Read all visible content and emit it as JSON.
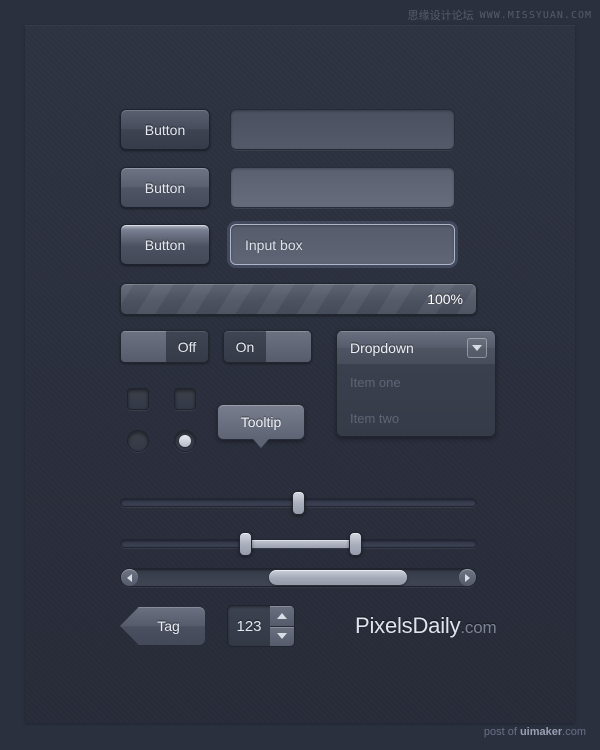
{
  "watermarks": {
    "top_cjk": "思缘设计论坛",
    "top_url": "WWW.MISSYUAN.COM",
    "bottom_prefix": "post of ",
    "bottom_brand": "uimaker",
    "bottom_suffix": ".com"
  },
  "buttons": {
    "normal_label": "Button",
    "hover_label": "Button",
    "active_label": "Button"
  },
  "inputs": {
    "plain_value": "",
    "light_value": "",
    "focused_value": "Input box"
  },
  "progress": {
    "label": "100%",
    "value": 100
  },
  "toggles": {
    "off_label": "Off",
    "on_label": "On"
  },
  "dropdown": {
    "title": "Dropdown",
    "arrow_icon": "chevron-down-icon",
    "items": [
      {
        "label": "Item one"
      },
      {
        "label": "Item two"
      }
    ]
  },
  "checkboxes": [
    {
      "checked": false
    },
    {
      "checked": false
    }
  ],
  "radios": [
    {
      "checked": false
    },
    {
      "checked": true
    }
  ],
  "tooltip": {
    "label": "Tooltip"
  },
  "sliders": {
    "single": {
      "handle_percent": 50
    },
    "range": {
      "start_percent": 35,
      "end_percent": 65
    }
  },
  "scrollbar": {
    "left_icon": "arrow-left-icon",
    "right_icon": "arrow-right-icon",
    "thumb_percent": 39
  },
  "tag": {
    "label": "Tag"
  },
  "stepper": {
    "value": "123",
    "up_icon": "arrow-up-icon",
    "down_icon": "arrow-down-icon"
  },
  "logo": {
    "name": "PixelsDaily",
    "tld": ".com"
  },
  "colors": {
    "background": "#2b303e",
    "panel": "#2e3342",
    "control": "#555b6a",
    "text": "#e6e9f0",
    "muted": "#5f6575",
    "focus_border": "#aeb6cc"
  }
}
